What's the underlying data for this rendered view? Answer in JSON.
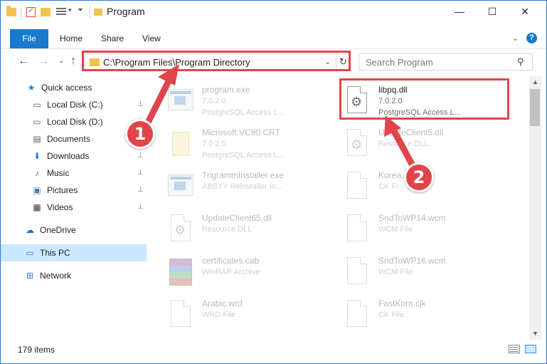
{
  "window": {
    "title": "Program",
    "controls": {
      "minimize": "—",
      "maximize": "☐",
      "close": "✕"
    }
  },
  "ribbon": {
    "tabs": [
      "File",
      "Home",
      "Share",
      "View"
    ],
    "expand_glyph": "⌄",
    "help_glyph": "?"
  },
  "nav": {
    "back_glyph": "←",
    "forward_glyph": "→",
    "recent_glyph": "⌄",
    "up_glyph": "↑",
    "address": "C:\\Program Files\\Program Directory",
    "address_drop": "⌄",
    "refresh_glyph": "↻",
    "search_placeholder": "Search Program",
    "search_glyph": "⚲"
  },
  "sidebar": {
    "items": [
      {
        "label": "Quick access",
        "icon": "star-icon",
        "glyph": "★",
        "color": "#2b79d8",
        "pinned": false
      },
      {
        "label": "Local Disk (C:)",
        "icon": "drive-icon",
        "glyph": "▭",
        "color": "#5a5a5a",
        "pinned": true
      },
      {
        "label": "Local Disk (D:)",
        "icon": "drive-icon",
        "glyph": "▭",
        "color": "#5a5a5a",
        "pinned": true
      },
      {
        "label": "Documents",
        "icon": "documents-icon",
        "glyph": "▤",
        "color": "#5a5a5a",
        "pinned": true
      },
      {
        "label": "Downloads",
        "icon": "download-icon",
        "glyph": "⬇",
        "color": "#2b79d8",
        "pinned": true
      },
      {
        "label": "Music",
        "icon": "music-icon",
        "glyph": "♪",
        "color": "#2b79d8",
        "pinned": true
      },
      {
        "label": "Pictures",
        "icon": "pictures-icon",
        "glyph": "▣",
        "color": "#4a7ab0",
        "pinned": true
      },
      {
        "label": "Videos",
        "icon": "video-icon",
        "glyph": "▦",
        "color": "#3a3a3a",
        "pinned": true
      },
      {
        "label": "OneDrive",
        "icon": "cloud-icon",
        "glyph": "☁",
        "color": "#1f6fd1",
        "pinned": false
      },
      {
        "label": "This PC",
        "icon": "computer-icon",
        "glyph": "▭",
        "color": "#3a8ad6",
        "pinned": false,
        "selected": true
      },
      {
        "label": "Network",
        "icon": "network-icon",
        "glyph": "⊞",
        "color": "#2b79d8",
        "pinned": false
      }
    ],
    "pin_glyph": "📌"
  },
  "files": [
    {
      "name": "program.exe",
      "line2": "7.0.2.0",
      "line3": "PostgreSQL Access L...",
      "icon": "exe",
      "faded": true
    },
    {
      "name": "libpq.dll",
      "line2": "7.0.2.0",
      "line3": "PostgreSQL Access L...",
      "icon": "dll",
      "faded": false
    },
    {
      "name": "Microsoft.VC90.CRT",
      "line2": "7.0.2.0",
      "line3": "PostgreSQL Access L...",
      "icon": "folder",
      "faded": true
    },
    {
      "name": "UpdateClient5.dll",
      "line2": "Resource DLL",
      "line3": "",
      "icon": "dll",
      "faded": true
    },
    {
      "name": "TrigrammInstaller.exe",
      "line2": "ABBYY Reinstaller In...",
      "line3": "",
      "icon": "exe",
      "faded": true
    },
    {
      "name": "Korea...",
      "line2": "CK Fi...",
      "line3": "",
      "icon": "doc",
      "faded": true
    },
    {
      "name": "UpdateClient65.dll",
      "line2": "Resource DLL",
      "line3": "",
      "icon": "dll",
      "faded": true
    },
    {
      "name": "SndToWP14.wcm",
      "line2": "WCM File",
      "line3": "",
      "icon": "doc",
      "faded": true
    },
    {
      "name": "certificates.cab",
      "line2": "WinRAR Archive",
      "line3": "",
      "icon": "rar",
      "faded": true
    },
    {
      "name": "SndToWP16.wcm",
      "line2": "WCM File",
      "line3": "",
      "icon": "doc",
      "faded": true
    },
    {
      "name": "Arabic.wrd",
      "line2": "WRD File",
      "line3": "",
      "icon": "doc",
      "faded": true
    },
    {
      "name": "FastKorn.cjk",
      "line2": "CK File",
      "line3": "",
      "icon": "doc",
      "faded": true
    }
  ],
  "status": {
    "item_count": "179 items"
  },
  "callouts": [
    "1",
    "2"
  ],
  "colors": {
    "accent": "#1979ca",
    "highlight": "#e0454a",
    "selection": "#cce8ff"
  }
}
